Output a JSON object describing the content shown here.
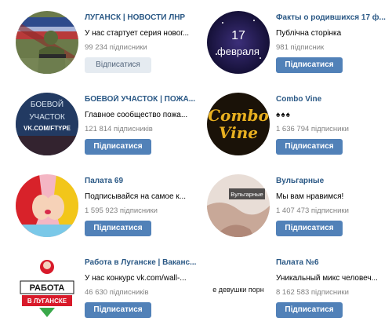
{
  "groups": [
    {
      "name": "ЛУГАНСК | НОВОСТИ ЛНР",
      "desc": "У нас стартует серия новог...",
      "subs": "99 234 підписники",
      "button": "Відписатися",
      "avatar": "soldier-flag-avatar"
    },
    {
      "name": "Факты о родившихся 17 ф...",
      "desc": "Публічна сторінка",
      "subs": "981 підписник",
      "button": "Підписатися",
      "avatar": "17-fevralya-avatar",
      "avatar_text_top": "17",
      "avatar_text_bottom": "февраля"
    },
    {
      "name": "БОЕВОЙ УЧАСТОК | ПОЖА...",
      "desc": "Главное сообщество пожа...",
      "subs": "121 814 підписників",
      "button": "Підписатися",
      "avatar": "boevoy-uchastok-avatar",
      "avatar_text_1": "БОЕВОЙ",
      "avatar_text_2": "УЧАСТОК",
      "avatar_text_3": "VK.COM/FTYPE"
    },
    {
      "name": "Combo Vine",
      "desc": "♠♠♠",
      "subs": "1 636 794 підписники",
      "button": "Підписатися",
      "avatar": "combo-vine-avatar",
      "avatar_text_1": "Combo",
      "avatar_text_2": "Vine"
    },
    {
      "name": "Палата 69",
      "desc": "Подписывайся на самое к...",
      "subs": "1 595 923 підписники",
      "button": "Підписатися",
      "avatar": "kissing-cartoon-avatar"
    },
    {
      "name": "Вульгарные",
      "desc": "Мы вам нравимся!",
      "subs": "1 407 473 підписники",
      "button": "Підписатися",
      "avatar": "vulgarnye-avatar",
      "avatar_text": "Вульгарные"
    },
    {
      "name": "Работа в Луганске | Ваканс...",
      "desc": "У нас конкурс vk.com/wall-...",
      "subs": "46 630 підписників",
      "button": "Підписатися",
      "avatar": "rabota-luganske-avatar",
      "avatar_text_1": "РАБОТА",
      "avatar_text_2": "В ЛУГАНСКЕ"
    },
    {
      "name": "Палата №6",
      "desc": "Уникальный микс человеч...",
      "subs": "8 162 583 підписники",
      "button": "Підписатися",
      "avatar": "devushki-avatar",
      "avatar_text": "е девушки порн"
    }
  ],
  "colors": {
    "link": "#2a5885",
    "button": "#5181b8",
    "button_gray": "#e5ebf1",
    "muted": "#828282"
  }
}
